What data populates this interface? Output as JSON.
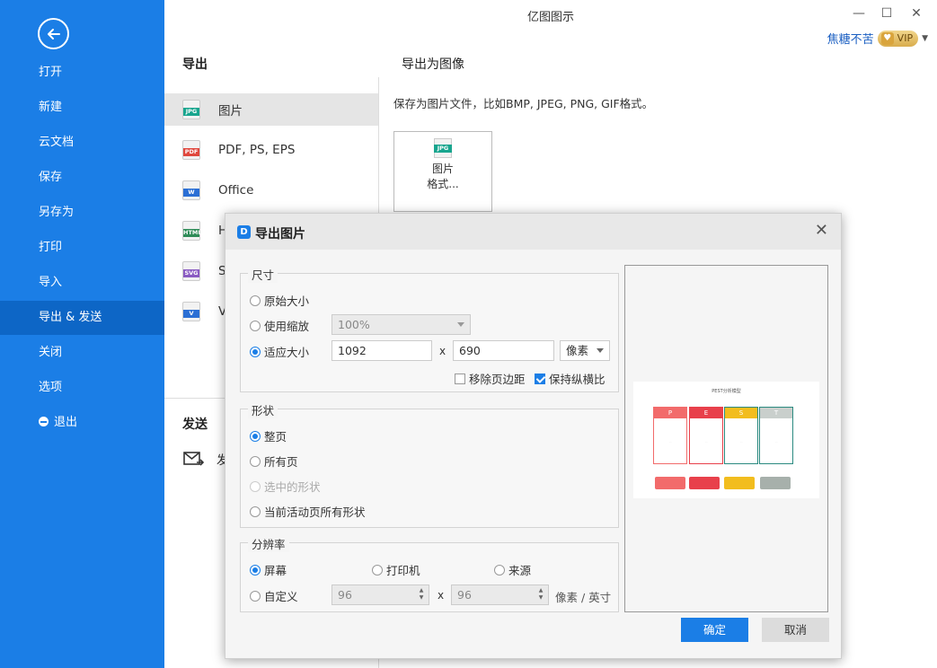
{
  "app": {
    "title": "亿图图示"
  },
  "window": {
    "minimize": "—",
    "maximize": "☐",
    "close": "✕"
  },
  "user": {
    "name": "焦糖不苦",
    "vip": "VIP"
  },
  "sidebar": {
    "items": [
      {
        "label": "打开"
      },
      {
        "label": "新建"
      },
      {
        "label": "云文档"
      },
      {
        "label": "保存"
      },
      {
        "label": "另存为"
      },
      {
        "label": "打印"
      },
      {
        "label": "导入"
      },
      {
        "label": "导出 & 发送",
        "active": true
      },
      {
        "label": "关闭"
      },
      {
        "label": "选项"
      },
      {
        "label": "退出"
      }
    ]
  },
  "export_panel": {
    "title": "导出",
    "formats": [
      {
        "label": "图片",
        "icon": "JPG",
        "color": "#18a58e"
      },
      {
        "label": "PDF, PS, EPS",
        "icon": "PDF",
        "color": "#e0483e"
      },
      {
        "label": "Office",
        "icon": "W",
        "color": "#2b6fd4"
      },
      {
        "label": "H",
        "icon": "HTML",
        "color": "#2e8b57"
      },
      {
        "label": "S",
        "icon": "SVG",
        "color": "#8a5cc2"
      },
      {
        "label": "V",
        "icon": "V",
        "color": "#2b6fd4"
      }
    ],
    "send_title": "发送",
    "send_item": "发"
  },
  "right_panel": {
    "title": "导出为图像",
    "desc": "保存为图片文件，比如BMP, JPEG, PNG, GIF格式。",
    "card": {
      "icon": "JPG",
      "line1": "图片",
      "line2": "格式..."
    }
  },
  "dialog": {
    "title": "导出图片",
    "close": "✕",
    "size": {
      "legend": "尺寸",
      "original": "原始大小",
      "use_zoom": "使用缩放",
      "zoom_value": "100%",
      "fit_size": "适应大小",
      "width": "1092",
      "height": "690",
      "times": "x",
      "unit": "像素",
      "remove_margin": "移除页边距",
      "keep_ratio": "保持纵横比"
    },
    "shape": {
      "legend": "形状",
      "whole_page": "整页",
      "all_pages": "所有页",
      "selected": "选中的形状",
      "current_all": "当前活动页所有形状"
    },
    "resolution": {
      "legend": "分辨率",
      "screen": "屏幕",
      "printer": "打印机",
      "source": "来源",
      "custom": "自定义",
      "x_value": "96",
      "y_value": "96",
      "times": "x",
      "unit": "像素 / 英寸"
    },
    "preview": {
      "title": "PEST分析模型",
      "columns": [
        {
          "letter": "P",
          "color": "#f26b6b"
        },
        {
          "letter": "E",
          "color": "#e8404b"
        },
        {
          "letter": "S",
          "color": "#f2bd1e"
        },
        {
          "letter": "T",
          "color": "#c9cfcc"
        }
      ],
      "tags": [
        "#f26b6b",
        "#e8404b",
        "#f2bd1e",
        "#a7b0ab"
      ]
    },
    "ok": "确定",
    "cancel": "取消"
  }
}
